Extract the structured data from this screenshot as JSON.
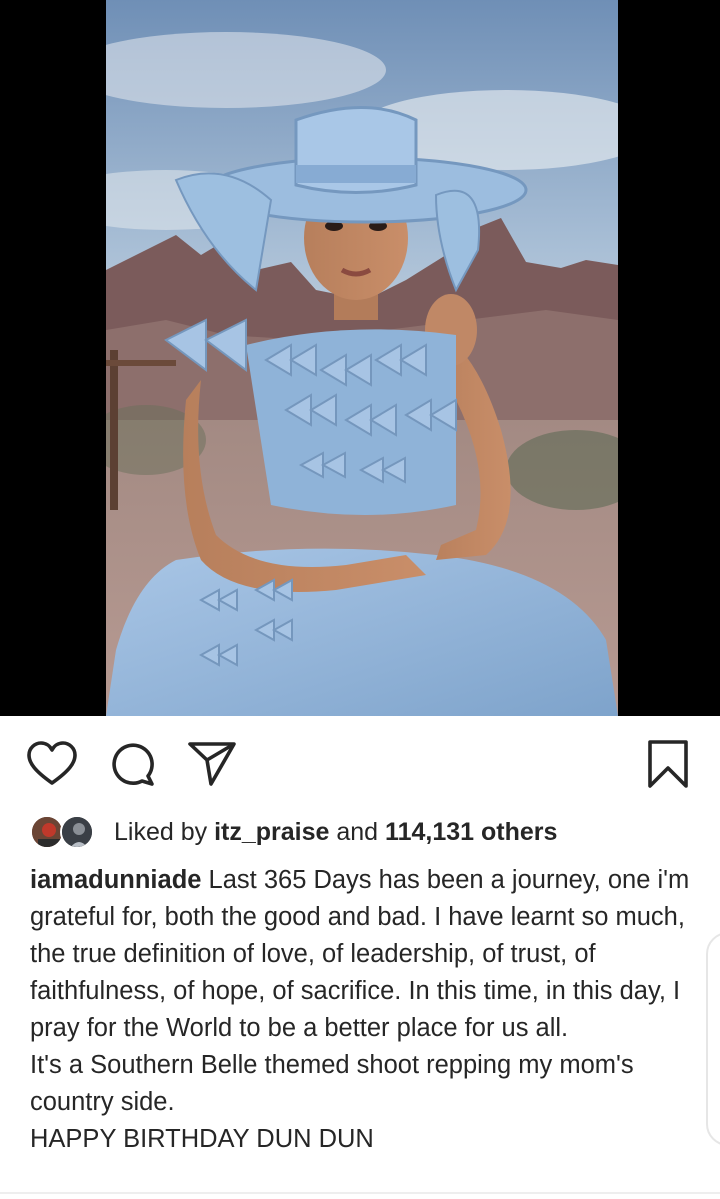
{
  "post": {
    "image_alt": "Woman in a light blue bow dress and wide-brim blue hat seated in front of a desert mountain backdrop",
    "likes": {
      "prefix": "Liked by",
      "user": "itz_praise",
      "middle": "and",
      "count": "114,131 others"
    },
    "caption": {
      "username": "iamadunniade",
      "line1": "Last 365 Days has been a journey, one i'm grateful for, both the good and bad. I have learnt so much, the true definition of love, of leadership, of trust, of faithfulness, of hope, of sacrifice. In this time, in this day, I pray for the World to be a better place for us all.",
      "line2": "It's a Southern Belle themed shoot repping my mom's country side.",
      "line3": "HAPPY BIRTHDAY DUN DUN"
    }
  },
  "icons": {
    "like": "heart-icon",
    "comment": "comment-icon",
    "share": "send-icon",
    "save": "bookmark-icon"
  },
  "colors": {
    "text": "#262626",
    "icon": "#262626",
    "background": "#ffffff",
    "letterbox": "#000000",
    "dress_blue": "#8fb3d8"
  }
}
